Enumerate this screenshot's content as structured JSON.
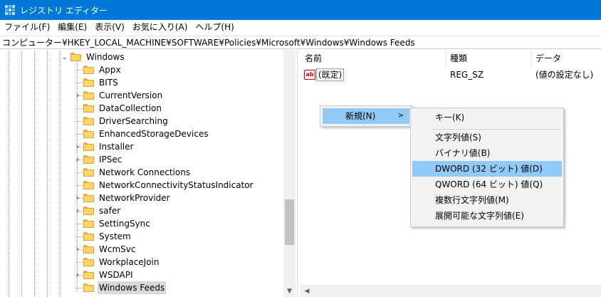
{
  "window": {
    "title": "レジストリ エディター"
  },
  "menu": [
    "ファイル(F)",
    "編集(E)",
    "表示(V)",
    "お気に入り(A)",
    "ヘルプ(H)"
  ],
  "address": "コンピューター¥HKEY_LOCAL_MACHINE¥SOFTWARE¥Policies¥Microsoft¥Windows¥Windows Feeds",
  "tree": {
    "parent": {
      "label": "Windows",
      "expanded": true
    },
    "items": [
      {
        "label": "Appx",
        "expandable": false
      },
      {
        "label": "BITS",
        "expandable": false
      },
      {
        "label": "CurrentVersion",
        "expandable": true
      },
      {
        "label": "DataCollection",
        "expandable": false
      },
      {
        "label": "DriverSearching",
        "expandable": false
      },
      {
        "label": "EnhancedStorageDevices",
        "expandable": false
      },
      {
        "label": "Installer",
        "expandable": true
      },
      {
        "label": "IPSec",
        "expandable": true
      },
      {
        "label": "Network Connections",
        "expandable": false
      },
      {
        "label": "NetworkConnectivityStatusIndicator",
        "expandable": false
      },
      {
        "label": "NetworkProvider",
        "expandable": true
      },
      {
        "label": "safer",
        "expandable": true
      },
      {
        "label": "SettingSync",
        "expandable": false
      },
      {
        "label": "System",
        "expandable": false
      },
      {
        "label": "WcmSvc",
        "expandable": true
      },
      {
        "label": "WorkplaceJoin",
        "expandable": false
      },
      {
        "label": "WSDAPI",
        "expandable": true
      },
      {
        "label": "Windows Feeds",
        "expandable": false,
        "selected": true
      }
    ]
  },
  "list": {
    "columns": [
      "名前",
      "種類",
      "データ"
    ],
    "rows": [
      {
        "name": "(既定)",
        "type": "REG_SZ",
        "data": "(値の設定なし)",
        "icon": "string-value-icon"
      }
    ]
  },
  "context_menu": {
    "new_label": "新規(N)",
    "arrow": ">"
  },
  "submenu": {
    "items": [
      {
        "label": "キー(K)",
        "highlighted": false
      },
      {
        "label": "文字列値(S)",
        "highlighted": false
      },
      {
        "label": "バイナリ値(B)",
        "highlighted": false
      },
      {
        "label": "DWORD (32 ビット) 値(D)",
        "highlighted": true
      },
      {
        "label": "QWORD (64 ビット) 値(Q)",
        "highlighted": false
      },
      {
        "label": "複数行文字列値(M)",
        "highlighted": false
      },
      {
        "label": "展開可能な文字列値(E)",
        "highlighted": false
      }
    ]
  },
  "colors": {
    "titlebar": "#0078d7",
    "highlight": "#91c9f7",
    "selection": "#d9d9d9",
    "folder": "#ffd56b"
  }
}
